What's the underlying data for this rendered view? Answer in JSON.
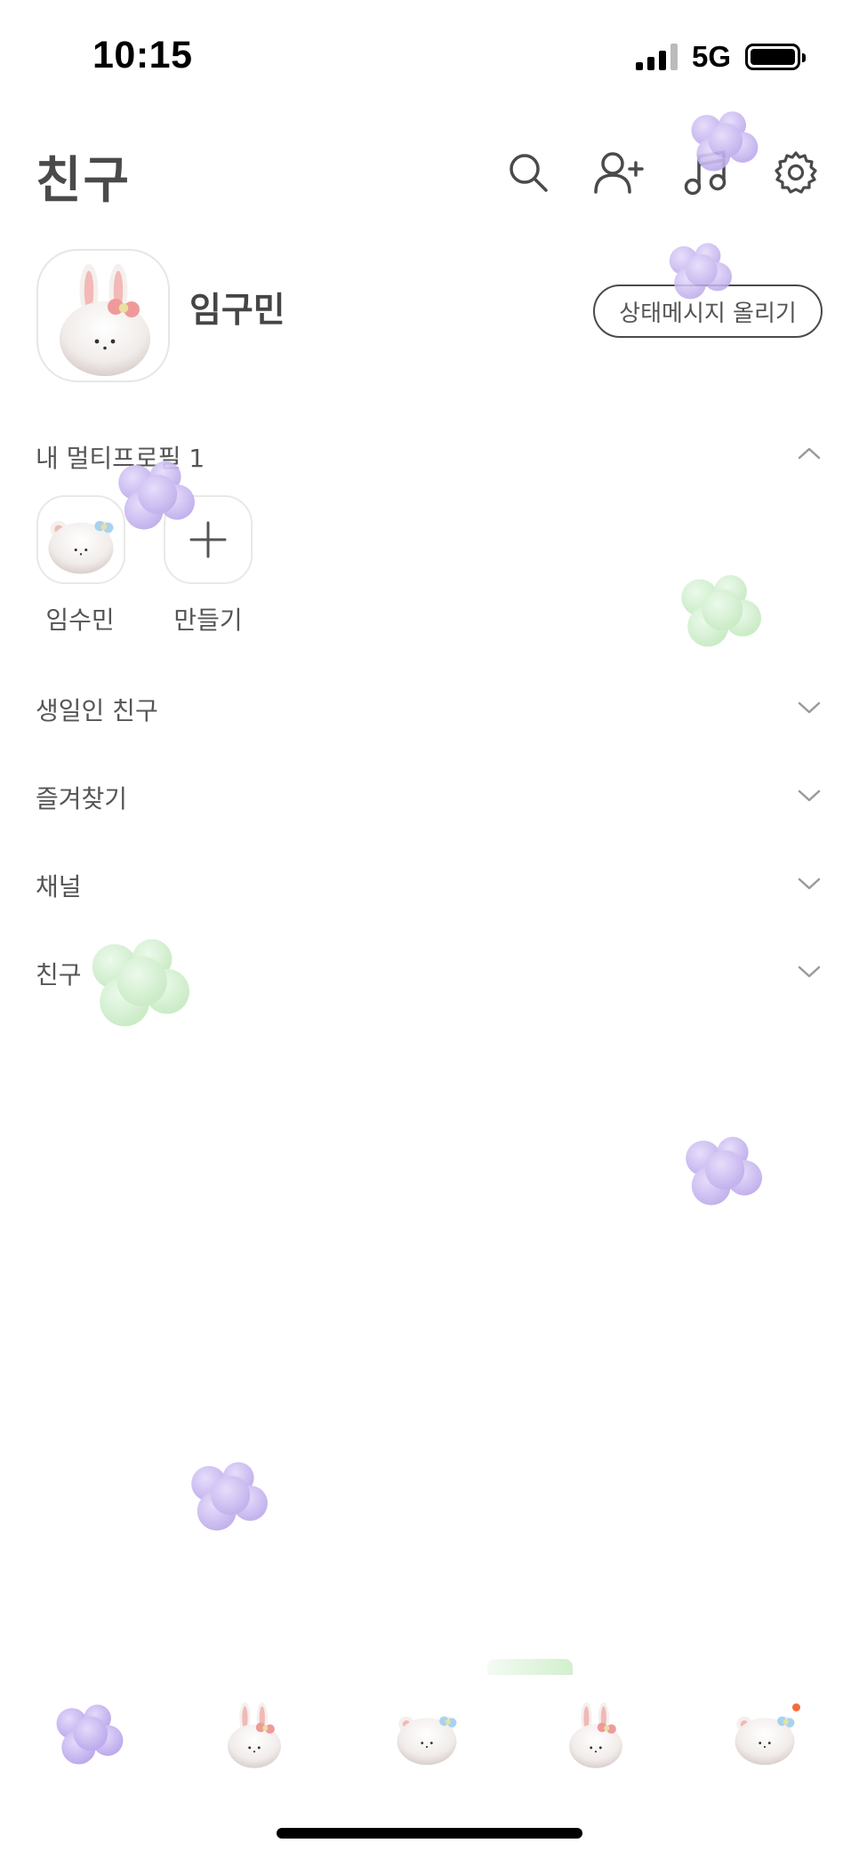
{
  "status_bar": {
    "time": "10:15",
    "network": "5G",
    "signal_bars": 4,
    "battery_level": 1.0
  },
  "header": {
    "title": "친구",
    "icons": [
      "search-icon",
      "add-friend-icon",
      "music-icon",
      "settings-icon"
    ]
  },
  "profile": {
    "name": "임구민",
    "status_button": "상태메시지 올리기"
  },
  "multi_profile": {
    "label": "내 멀티프로필 1",
    "items": [
      {
        "label": "임수민",
        "icon": "bear-character-icon"
      },
      {
        "label": "만들기",
        "icon": "plus-icon"
      }
    ]
  },
  "sections": {
    "birthday": "생일인 친구",
    "favorites": "즐겨찾기",
    "channels": "채널",
    "friends": "친구"
  },
  "tab_bar": {
    "tabs": [
      {
        "icon": "purple-cloud-icon"
      },
      {
        "icon": "bunny-character-icon"
      },
      {
        "icon": "bear-character-icon"
      },
      {
        "icon": "bunny-character-icon"
      },
      {
        "icon": "bear-character-icon",
        "has_notification": true
      }
    ]
  },
  "colors": {
    "accent_notification": "#f26b3a",
    "deco_purple": "#c9b8f0",
    "deco_green": "#cdeec8"
  }
}
